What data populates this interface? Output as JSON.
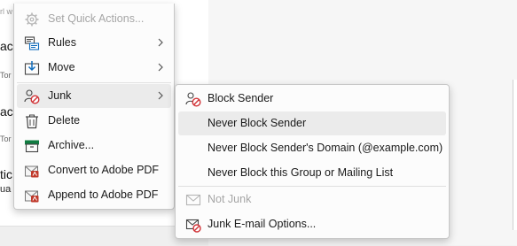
{
  "background": {
    "search_hint": "rl w",
    "fragments": [
      "ac",
      "ac",
      "ac",
      "tic",
      "ua"
    ],
    "small_fragments": [
      "Tor",
      "Tor",
      "Tor"
    ]
  },
  "context_menu": {
    "items": [
      {
        "label": "Set Quick Actions...",
        "icon": "lightning-gear-icon",
        "disabled": true
      },
      {
        "label": "Rules",
        "icon": "rules-icon",
        "submenu": true
      },
      {
        "label": "Move",
        "icon": "move-icon",
        "submenu": true
      },
      {
        "label": "Junk",
        "icon": "junk-icon",
        "submenu": true,
        "highlighted": true
      },
      {
        "label": "Delete",
        "icon": "trash-icon"
      },
      {
        "label": "Archive...",
        "icon": "archive-icon"
      },
      {
        "label": "Convert to Adobe PDF",
        "icon": "adobe-pdf-icon"
      },
      {
        "label": "Append to Adobe PDF",
        "icon": "adobe-pdf-append-icon"
      }
    ]
  },
  "junk_submenu": {
    "items": [
      {
        "label": "Block Sender",
        "icon": "block-sender-icon"
      },
      {
        "label": "Never Block Sender",
        "highlighted": true
      },
      {
        "label": "Never Block Sender's Domain (@example.com)"
      },
      {
        "label": "Never Block this Group or Mailing List"
      },
      {
        "label": "Not Junk",
        "icon": "not-junk-mail-icon",
        "disabled": true
      },
      {
        "label": "Junk E-mail Options...",
        "icon": "junk-options-icon"
      }
    ]
  },
  "colors": {
    "menu_bg": "#fcfcfc",
    "highlight": "#ebebeb",
    "junk_red": "#d13438",
    "archive_green": "#107c41",
    "move_blue": "#0f6cbd",
    "adobe_red": "#c0392b",
    "disabled_text": "#a6a6a6"
  }
}
